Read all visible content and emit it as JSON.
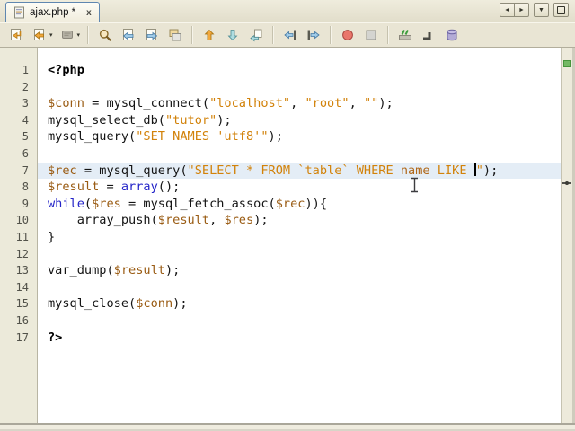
{
  "tab_bar": {
    "tabs": [
      {
        "label": "ajax.php *",
        "modified": true,
        "active": true,
        "close_label": "x"
      }
    ],
    "controls": {
      "scroll_left": "◄",
      "scroll_right": "►",
      "tab_list": "▼"
    }
  },
  "toolbar": {
    "groups": [
      [
        {
          "name": "last-edit-position"
        },
        {
          "name": "back",
          "dropdown": true
        },
        {
          "name": "annotations",
          "dropdown": true
        }
      ],
      [
        {
          "name": "find"
        },
        {
          "name": "find-previous"
        },
        {
          "name": "find-next"
        },
        {
          "name": "toggle-highlight"
        }
      ],
      [
        {
          "name": "previous-bookmark"
        },
        {
          "name": "next-bookmark"
        },
        {
          "name": "toggle-bookmark"
        }
      ],
      [
        {
          "name": "shift-line-left"
        },
        {
          "name": "shift-line-right"
        }
      ],
      [
        {
          "name": "start-macro-recording"
        },
        {
          "name": "stop-macro-recording"
        }
      ],
      [
        {
          "name": "toggle-comment"
        },
        {
          "name": "format-code"
        },
        {
          "name": "database"
        }
      ]
    ]
  },
  "editor": {
    "language": "php",
    "current_line": 7,
    "caret": {
      "line": 7,
      "column": 59
    },
    "error_stripe": {
      "status": "no-errors",
      "status_color": "#74b964"
    },
    "lines": [
      {
        "n": 1,
        "tokens": [
          [
            "<?php",
            "tag"
          ]
        ]
      },
      {
        "n": 2,
        "tokens": []
      },
      {
        "n": 3,
        "tokens": [
          [
            "$conn",
            "var"
          ],
          [
            " = mysql_connect(",
            "pl"
          ],
          [
            "\"localhost\"",
            "str"
          ],
          [
            ", ",
            "pl"
          ],
          [
            "\"root\"",
            "str"
          ],
          [
            ", ",
            "pl"
          ],
          [
            "\"\"",
            "str"
          ],
          [
            ");",
            "pl"
          ]
        ]
      },
      {
        "n": 4,
        "tokens": [
          [
            "mysql_select_db(",
            "pl"
          ],
          [
            "\"tutor\"",
            "str"
          ],
          [
            ");",
            "pl"
          ]
        ]
      },
      {
        "n": 5,
        "tokens": [
          [
            "mysql_query(",
            "pl"
          ],
          [
            "\"SET NAMES 'utf8'\"",
            "str"
          ],
          [
            ");",
            "pl"
          ]
        ]
      },
      {
        "n": 6,
        "tokens": []
      },
      {
        "n": 7,
        "tokens": [
          [
            "$rec",
            "var"
          ],
          [
            " = mysql_query(",
            "pl"
          ],
          [
            "\"SELECT * FROM `table` WHERE ",
            "str"
          ],
          [
            "name",
            "sql"
          ],
          [
            " LIKE ",
            "str"
          ],
          [
            "",
            "caret"
          ],
          [
            "\"",
            "str"
          ],
          [
            ");",
            "pl"
          ]
        ]
      },
      {
        "n": 8,
        "tokens": [
          [
            "$result",
            "var"
          ],
          [
            " = ",
            "pl"
          ],
          [
            "array",
            "kw"
          ],
          [
            "();",
            "pl"
          ]
        ]
      },
      {
        "n": 9,
        "tokens": [
          [
            "while",
            "kw"
          ],
          [
            "(",
            "pl"
          ],
          [
            "$res",
            "var"
          ],
          [
            " = mysql_fetch_assoc(",
            "pl"
          ],
          [
            "$rec",
            "var"
          ],
          [
            ")){",
            "pl"
          ]
        ]
      },
      {
        "n": 10,
        "tokens": [
          [
            "    array_push(",
            "pl"
          ],
          [
            "$result",
            "var"
          ],
          [
            ", ",
            "pl"
          ],
          [
            "$res",
            "var"
          ],
          [
            ");",
            "pl"
          ]
        ]
      },
      {
        "n": 11,
        "tokens": [
          [
            "}",
            "pl"
          ]
        ]
      },
      {
        "n": 12,
        "tokens": []
      },
      {
        "n": 13,
        "tokens": [
          [
            "var_dump(",
            "pl"
          ],
          [
            "$result",
            "var"
          ],
          [
            ");",
            "pl"
          ]
        ]
      },
      {
        "n": 14,
        "tokens": []
      },
      {
        "n": 15,
        "tokens": [
          [
            "mysql_close(",
            "pl"
          ],
          [
            "$conn",
            "var"
          ],
          [
            ");",
            "pl"
          ]
        ]
      },
      {
        "n": 16,
        "tokens": []
      },
      {
        "n": 17,
        "tokens": [
          [
            "?>",
            "tag"
          ]
        ]
      }
    ]
  },
  "colors": {
    "chrome_background": "#e9e5d4",
    "editor_background": "#ffffff",
    "gutter_background": "#eceada",
    "current_line_background": "#e4edf6",
    "string": "#d2820a",
    "variable": "#9a5c14",
    "keyword": "#2424c8",
    "sql_identifier": "#b0681a",
    "php_tag": "#000000",
    "active_tab_border": "#5f87b0",
    "error_stripe_ok": "#74b964"
  }
}
